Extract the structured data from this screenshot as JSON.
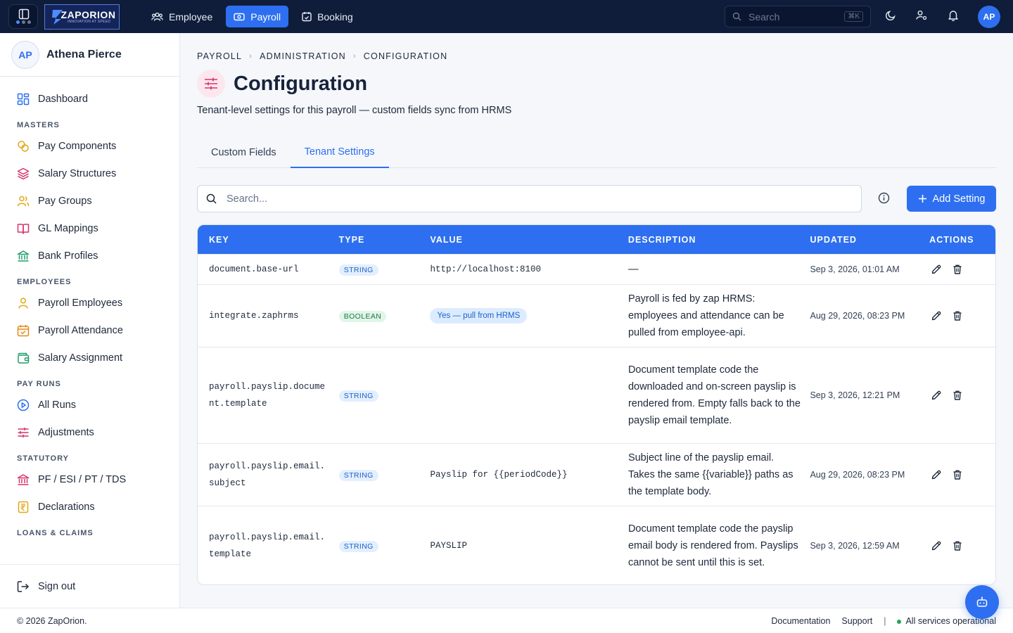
{
  "topbar": {
    "brand": "ZAPORION",
    "brand_tagline": "INNOVATION AT SPEED",
    "nav": [
      {
        "label": "Employee",
        "icon": "users-icon",
        "active": false
      },
      {
        "label": "Payroll",
        "icon": "payroll-icon",
        "active": true
      },
      {
        "label": "Booking",
        "icon": "calendar-check-icon",
        "active": false
      }
    ],
    "search_placeholder": "Search",
    "search_shortcut": "⌘K",
    "avatar_initials": "AP"
  },
  "sidebar": {
    "user_initials": "AP",
    "user_name": "Athena Pierce",
    "dashboard": "Dashboard",
    "sections": {
      "masters": "MASTERS",
      "employees": "EMPLOYEES",
      "payruns": "PAY RUNS",
      "statutory": "STATUTORY",
      "loans": "LOANS & CLAIMS"
    },
    "masters_items": [
      "Pay Components",
      "Salary Structures",
      "Pay Groups",
      "GL Mappings",
      "Bank Profiles"
    ],
    "employees_items": [
      "Payroll Employees",
      "Payroll Attendance",
      "Salary Assignment"
    ],
    "payruns_items": [
      "All Runs",
      "Adjustments"
    ],
    "statutory_items": [
      "PF / ESI / PT / TDS",
      "Declarations"
    ],
    "signout": "Sign out"
  },
  "main": {
    "breadcrumb": [
      "PAYROLL",
      "ADMINISTRATION",
      "CONFIGURATION"
    ],
    "title": "Configuration",
    "subtitle": "Tenant-level settings for this payroll — custom fields sync from HRMS",
    "tabs": [
      {
        "label": "Custom Fields",
        "active": false
      },
      {
        "label": "Tenant Settings",
        "active": true
      }
    ],
    "search_placeholder": "Search...",
    "add_button": "Add Setting"
  },
  "table": {
    "columns": [
      "KEY",
      "TYPE",
      "VALUE",
      "DESCRIPTION",
      "UPDATED",
      "ACTIONS"
    ],
    "rows": [
      {
        "key": "document.base-url",
        "type": "STRING",
        "value": "http://localhost:8100",
        "value_kind": "mono",
        "description": "—",
        "updated": "Sep 3, 2026, 01:01 AM"
      },
      {
        "key": "integrate.zaphrms",
        "type": "BOOLEAN",
        "value": "Yes — pull from HRMS",
        "value_kind": "pill",
        "description": "Payroll is fed by zap HRMS: employees and attendance can be pulled from employee-api.",
        "updated": "Aug 29, 2026, 08:23 PM"
      },
      {
        "key": "payroll.payslip.document.template",
        "type": "STRING",
        "value": "",
        "value_kind": "mono",
        "description": "Document template code the downloaded and on-screen payslip is rendered from. Empty falls back to the payslip email template.",
        "updated": "Sep 3, 2026, 12:21 PM"
      },
      {
        "key": "payroll.payslip.email.subject",
        "type": "STRING",
        "value": "Payslip for {{periodCode}}",
        "value_kind": "mono",
        "description": "Subject line of the payslip email. Takes the same {{variable}} paths as the template body.",
        "updated": "Aug 29, 2026, 08:23 PM"
      },
      {
        "key": "payroll.payslip.email.template",
        "type": "STRING",
        "value": "PAYSLIP",
        "value_kind": "mono",
        "description": "Document template code the payslip email body is rendered from. Payslips cannot be sent until this is set.",
        "updated": "Sep 3, 2026, 12:59 AM"
      }
    ]
  },
  "footer": {
    "copyright": "© 2026 ZapOrion.",
    "documentation": "Documentation",
    "support": "Support",
    "divider": "|",
    "status": "All services operational"
  },
  "colors": {
    "accent": "#2d6ff0",
    "topbar": "#0f1d3a",
    "status_ok": "#22a55a"
  }
}
